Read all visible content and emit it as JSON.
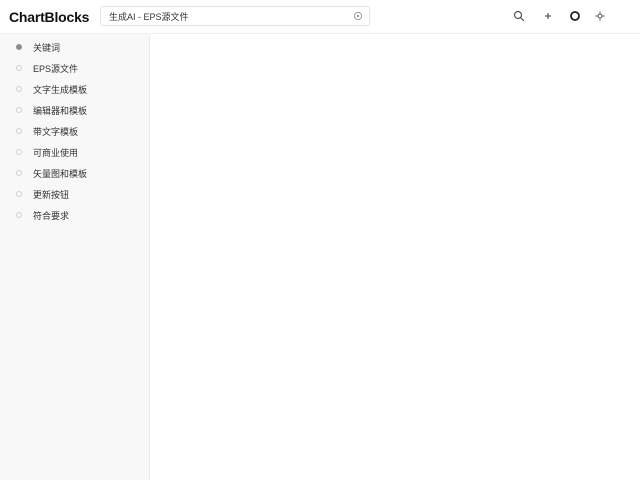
{
  "app": {
    "name": "ChartBlocks"
  },
  "search": {
    "value": "生成AI - EPS源文件"
  },
  "toolbar": {
    "icons": [
      "search-icon",
      "plus-icon",
      "circle-icon",
      "settings-icon"
    ]
  },
  "sidebar": {
    "items": [
      {
        "label": "关键词",
        "active": true
      },
      {
        "label": "EPS源文件",
        "active": false
      },
      {
        "label": "文字生成模板",
        "active": false
      },
      {
        "label": "编辑器和模板",
        "active": false
      },
      {
        "label": "带文字模板",
        "active": false
      },
      {
        "label": "可商业使用",
        "active": false
      },
      {
        "label": "矢量图和模板",
        "active": false
      },
      {
        "label": "更新按钮",
        "active": false
      },
      {
        "label": "符合要求",
        "active": false
      }
    ]
  }
}
